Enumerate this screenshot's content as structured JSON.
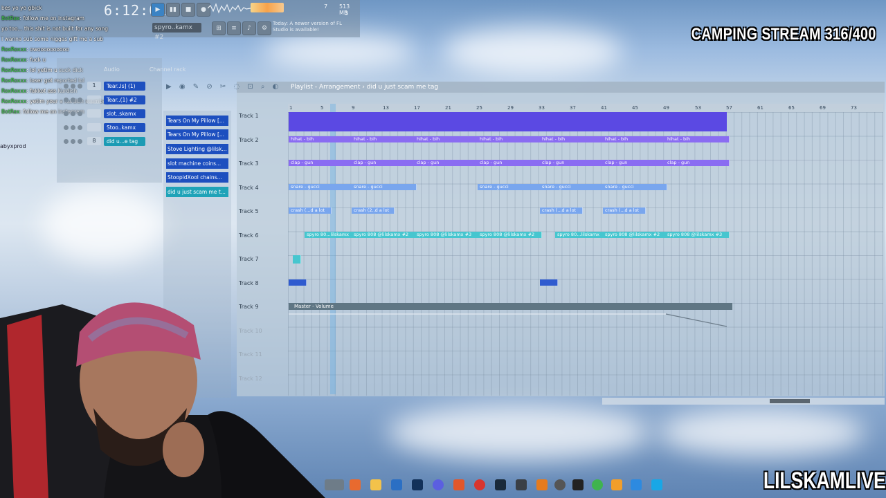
{
  "stream_overlay": {
    "title": "CAMPING STREAM 316/400",
    "brand": "LILSKAMLIVE"
  },
  "toolbar": {
    "clock": "6:12:01",
    "cpu_value": "7",
    "memory": "513 MB",
    "voices": "3",
    "pattern": "spyro..kamx #2",
    "update_hint": "Today: A newer version of FL Studio is available!"
  },
  "chat": [
    {
      "user": "",
      "text": "bes yo yo gbick"
    },
    {
      "user": "BotRex",
      "text": "follow me on instagram"
    },
    {
      "user": "",
      "text": "yo too... this shit is not built for any song"
    },
    {
      "user": "",
      "text": "I wanna sub some niggas gift me a sub"
    },
    {
      "user": "RoxRoxxx",
      "text": "owoooooooooo"
    },
    {
      "user": "RoxRoxxx",
      "text": "fuck u"
    },
    {
      "user": "RoxRoxxx",
      "text": "lol yetim u suck dick"
    },
    {
      "user": "RoxRoxxx",
      "text": "loser got reported lol"
    },
    {
      "user": "RoxRoxxx",
      "text": "fakkot ass Kurdish"
    },
    {
      "user": "RoxRoxxx",
      "text": "yetim your a Kurdish scumbag"
    },
    {
      "user": "BotRex",
      "text": "follow me on instagram"
    }
  ],
  "side_label": "abyxprod",
  "channel_rack": {
    "title": "Channel rack",
    "audio_label": "Audio",
    "channels": [
      {
        "num": "1",
        "name": "Tear..ls] (1)"
      },
      {
        "num": "",
        "name": "Tear..(1) #2"
      },
      {
        "num": "",
        "name": "slot..skamx"
      },
      {
        "num": "",
        "name": "Stoo..kamx"
      },
      {
        "num": "8",
        "name": "did u...e tag"
      }
    ]
  },
  "browser": {
    "items": [
      "Tears On My Pillow [...",
      "Tears On My Pillow [...",
      "Stove Lighting @lilsk...",
      "slot machine coins...",
      "StoopidXool chains...",
      "did u just scam me t..."
    ]
  },
  "playlist": {
    "title": "Playlist - Arrangement",
    "separator": "›",
    "song": "did u just scam me tag",
    "ruler": [
      "1",
      "5",
      "9",
      "13",
      "17",
      "21",
      "25",
      "29",
      "33",
      "37",
      "41",
      "45",
      "49",
      "53",
      "57",
      "61",
      "65",
      "69",
      "73"
    ],
    "tracks": [
      "Track 1",
      "Track 2",
      "Track 3",
      "Track 4",
      "Track 5",
      "Track 6",
      "Track 7",
      "Track 8",
      "Track 9",
      "Track 10",
      "Track 11",
      "Track 12"
    ],
    "clips": {
      "hihat": "hihat - bih",
      "clap": "clap - gun",
      "snare": "snare - gucci",
      "crash1": "crash (...d a lot",
      "crash2": "crash (2..d a lot",
      "spyro1": "spyro 808 @lilskamx",
      "spyro2": "spyro 808 @lilskamx #2",
      "spyro3": "spyro 808 @lilskamx #3",
      "spyro_short": "spyro 80...lilskamx"
    },
    "master": "Master - Volume"
  },
  "colors": {
    "purple": "#8a6cf2",
    "blue": "#1d4fbf",
    "teal": "#46c6cf"
  }
}
